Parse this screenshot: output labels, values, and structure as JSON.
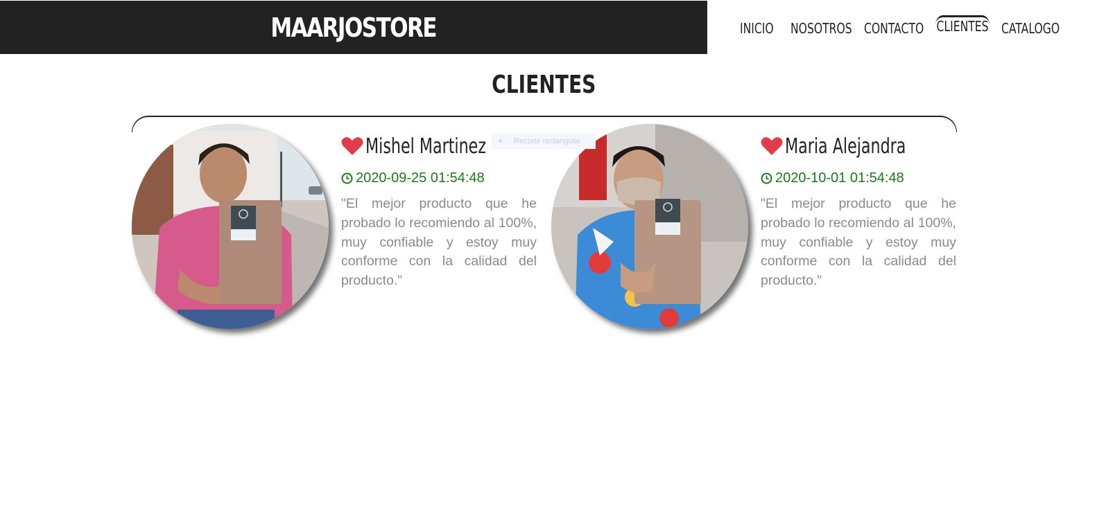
{
  "header": {
    "brand": "MAARJOSTORE",
    "nav": [
      "INICIO",
      "NOSOTROS",
      "CONTACTO",
      "CLIENTES",
      "CATALOGO"
    ],
    "active_nav": "CLIENTES"
  },
  "section": {
    "title": "CLIENTES"
  },
  "overlay": {
    "text": "Recorte rectangular"
  },
  "testimonials": [
    {
      "name": "Mishel Martinez",
      "date": "2020-09-25 01:54:48",
      "quote": "\"El mejor producto que he probado lo recomiendo al 100%, muy confiable y estoy muy conforme con la calidad del producto.\"",
      "icons": {
        "name": "heart-icon",
        "date": "clock-icon"
      }
    },
    {
      "name": "Maria Alejandra",
      "date": "2020-10-01 01:54:48",
      "quote": "\"El mejor producto que he probado lo recomiendo al 100%, muy confiable y estoy muy conforme con la calidad del producto.\"",
      "icons": {
        "name": "heart-icon",
        "date": "clock-icon"
      }
    }
  ],
  "colors": {
    "header_bg": "#222222",
    "heart": "#e03c4a",
    "date": "#1a7a1a",
    "quote": "#8a8a8a"
  }
}
